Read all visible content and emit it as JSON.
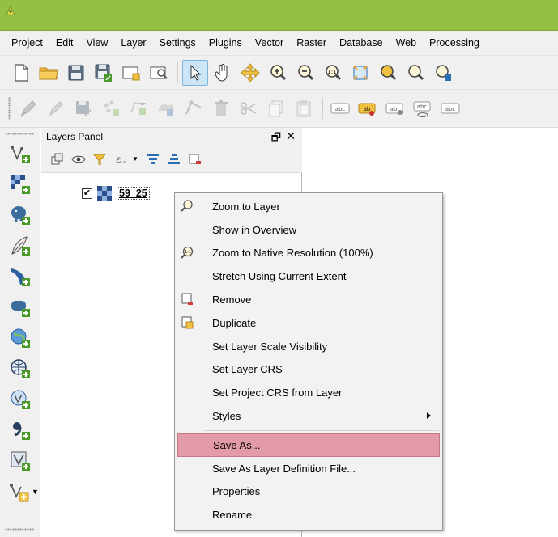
{
  "menubar": {
    "items": [
      "Project",
      "Edit",
      "View",
      "Layer",
      "Settings",
      "Plugins",
      "Vector",
      "Raster",
      "Database",
      "Web",
      "Processing"
    ]
  },
  "layers_panel": {
    "title": "Layers Panel",
    "float_glyph": "🗗",
    "close_glyph": "✕",
    "layer": {
      "name": "59_25",
      "checked": true,
      "check_glyph": "✔"
    }
  },
  "context_menu": {
    "items": [
      {
        "label": "Zoom to Layer",
        "icon": "zoom-magnifier-icon"
      },
      {
        "label": "Show in Overview",
        "icon": ""
      },
      {
        "label": "Zoom to Native Resolution (100%)",
        "icon": "zoom-native-icon"
      },
      {
        "label": "Stretch Using Current Extent",
        "icon": ""
      },
      {
        "label": "Remove",
        "icon": "remove-layer-icon"
      },
      {
        "label": "Duplicate",
        "icon": "duplicate-layer-icon"
      },
      {
        "label": "Set Layer Scale Visibility",
        "icon": ""
      },
      {
        "label": "Set Layer CRS",
        "icon": ""
      },
      {
        "label": "Set Project CRS from Layer",
        "icon": ""
      },
      {
        "label": "Styles",
        "icon": "",
        "submenu": true
      },
      {
        "label": "Save As...",
        "icon": "",
        "highlighted": true
      },
      {
        "label": "Save As Layer Definition File...",
        "icon": ""
      },
      {
        "label": "Properties",
        "icon": ""
      },
      {
        "label": "Rename",
        "icon": ""
      }
    ],
    "highlight_color": "#e39aa9"
  },
  "colors": {
    "titlebar": "#94c145",
    "toolbar_bg": "#f0f0f0",
    "accent_yellow": "#f0c040",
    "accent_blue": "#2a6fb3",
    "accent_green": "#4c9a2a"
  }
}
